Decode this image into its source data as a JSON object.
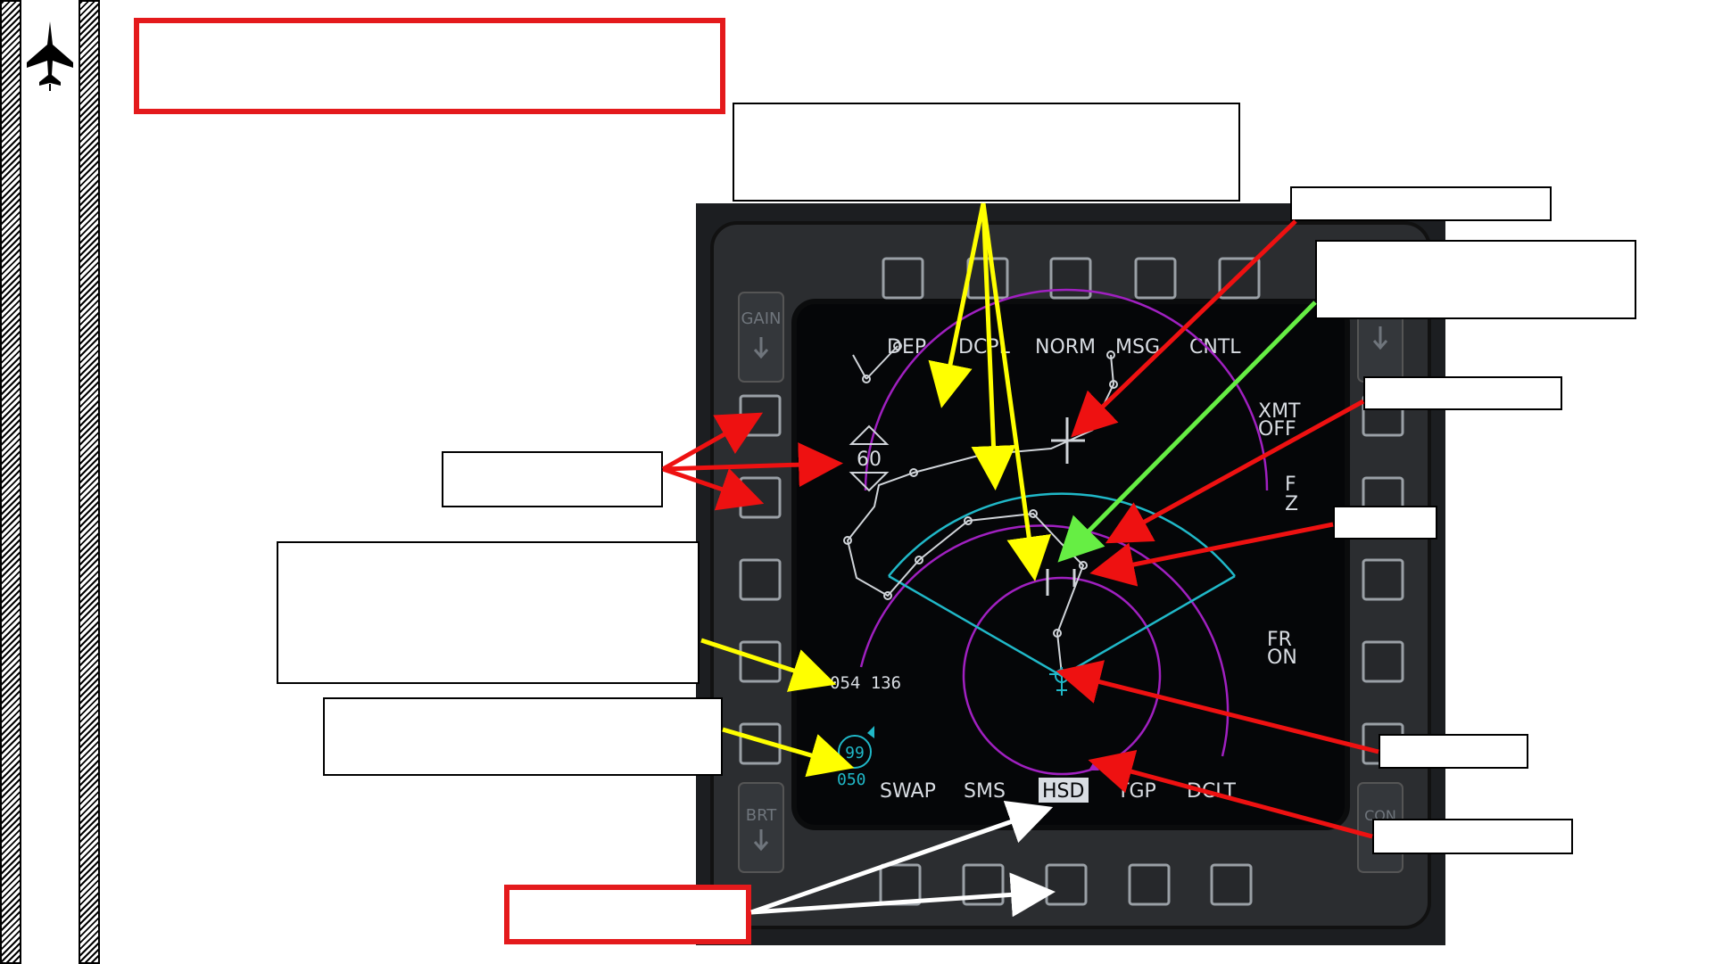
{
  "mfd": {
    "top_labels": [
      "DEP",
      "DCPL",
      "NORM",
      "MSG",
      "CNTL"
    ],
    "bottom_labels": [
      "SWAP",
      "SMS",
      "HSD",
      "TGP",
      "DCLT"
    ],
    "selected_bottom": "HSD",
    "xmt_line1": "XMT",
    "xmt_line2": "OFF",
    "fz_line1": "F",
    "fz_line2": "Z",
    "frz_line1": "FR",
    "frz_line2": "ON",
    "range_value": "60",
    "bullseye_readout": "054 136",
    "steerpoint_number": "99",
    "steerpoint_heading": "050",
    "gain_label": "GAIN",
    "brt_label": "BRT",
    "con_label": "CON"
  },
  "colors": {
    "callout_red": "#e41a1c",
    "arrow_yellow": "#ffff00",
    "arrow_red": "#ee1111",
    "arrow_green": "#66ee44",
    "arrow_white": "#ffffff",
    "range_ring": "#a020c0",
    "fov": "#20b8c8",
    "display_bg": "#050608",
    "bezel": "#2b2d30"
  }
}
